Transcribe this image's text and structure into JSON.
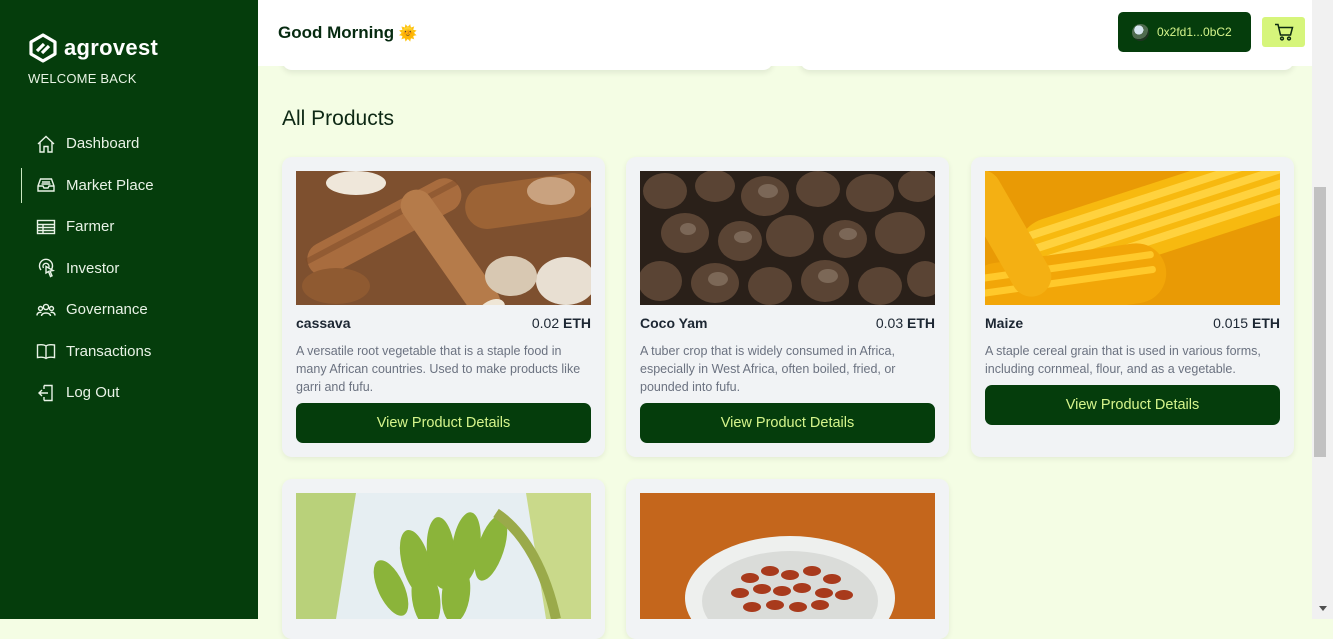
{
  "brand": {
    "name": "agrovest",
    "welcome": "WELCOME BACK"
  },
  "nav": [
    {
      "label": "Dashboard",
      "icon": "home-icon"
    },
    {
      "label": "Market Place",
      "icon": "inbox-icon",
      "active": true
    },
    {
      "label": "Farmer",
      "icon": "table-icon"
    },
    {
      "label": "Investor",
      "icon": "pointer-icon"
    },
    {
      "label": "Governance",
      "icon": "users-icon"
    },
    {
      "label": "Transactions",
      "icon": "book-icon"
    },
    {
      "label": "Log Out",
      "icon": "logout-icon"
    }
  ],
  "header": {
    "greeting": "Good Morning",
    "greeting_emoji": "🌞",
    "wallet_address": "0x2fd1...0bC2",
    "cart_icon": "cart-icon"
  },
  "section_title": "All Products",
  "products": [
    {
      "name": "cassava",
      "price": "0.02",
      "currency": "ETH",
      "description": "A versatile root vegetable that is a staple food in many African countries. Used to make products like garri and fufu.",
      "button": "View Product Details"
    },
    {
      "name": "Coco Yam",
      "price": "0.03",
      "currency": "ETH",
      "description": "A tuber crop that is widely consumed in Africa, especially in West Africa, often boiled, fried, or pounded into fufu.",
      "button": "View Product Details"
    },
    {
      "name": "Maize",
      "price": "0.015",
      "currency": "ETH",
      "description": "A staple cereal grain that is used in various forms, including cornmeal, flour, and as a vegetable.",
      "button": "View Product Details"
    }
  ],
  "colors": {
    "sidebar": "#053d0c",
    "accent": "#d6f57b",
    "background": "#f4fde4"
  }
}
